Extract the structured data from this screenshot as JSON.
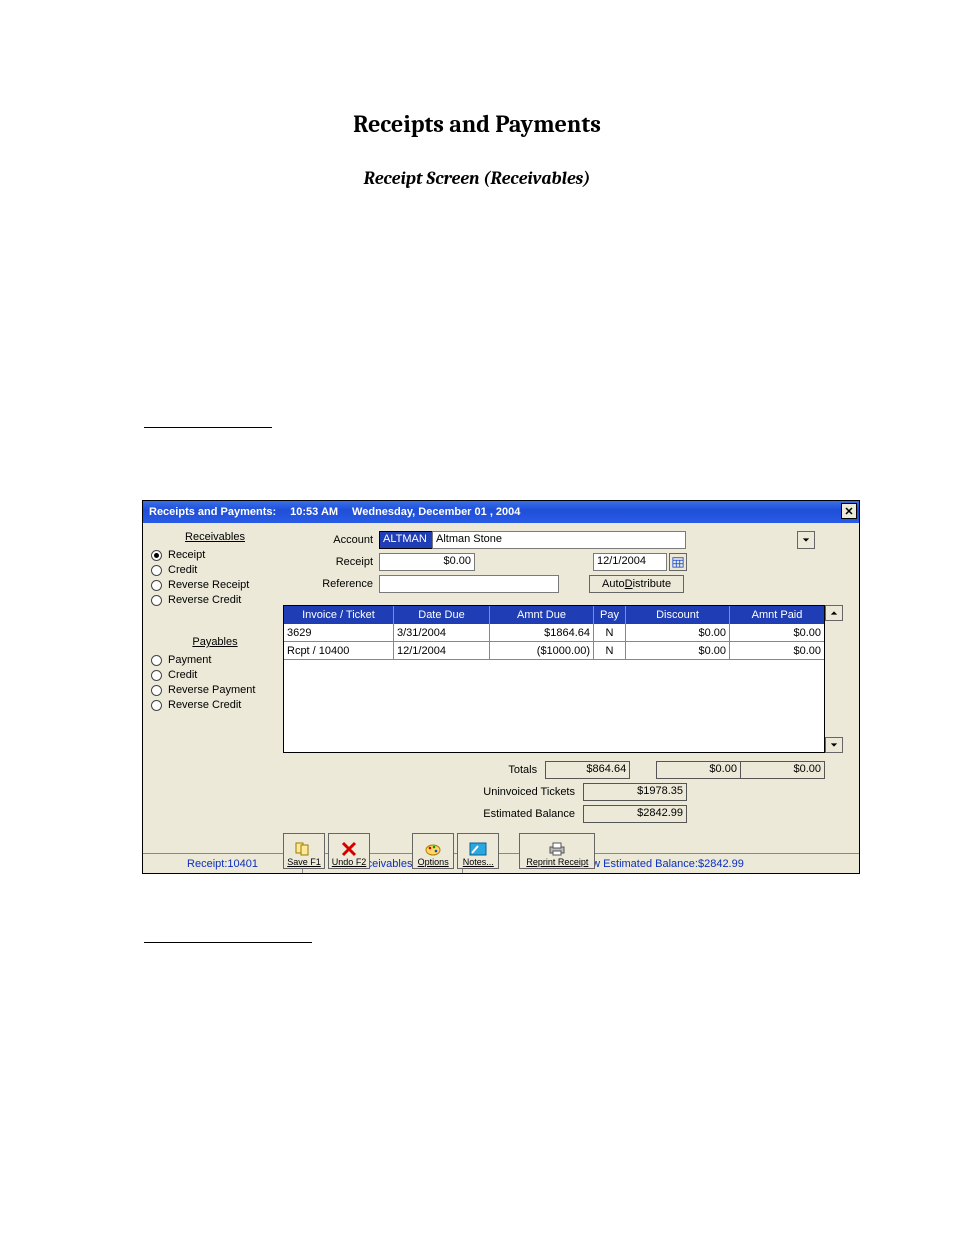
{
  "page_title": "Receipts and Payments",
  "page_subtitle": "Receipt Screen (Receivables)",
  "titlebar": {
    "app": "Receipts and Payments:",
    "time": "10:53 AM",
    "date": "Wednesday, December 01 , 2004"
  },
  "leftPanel": {
    "receivables_header": "Receivables",
    "receivables_options": [
      "Receipt",
      "Credit",
      "Reverse Receipt",
      "Reverse Credit"
    ],
    "receivables_selected_index": 0,
    "payables_header": "Payables",
    "payables_options": [
      "Payment",
      "Credit",
      "Reverse Payment",
      "Reverse Credit"
    ],
    "payables_selected_index": -1
  },
  "form": {
    "account_label": "Account",
    "account_code": "ALTMAN",
    "account_name": "Altman Stone",
    "receipt_label": "Receipt",
    "receipt_amount": "$0.00",
    "date": "12/1/2004",
    "reference_label": "Reference",
    "reference_value": "",
    "auto_distribute_prefix": "Auto ",
    "auto_distribute_hot": "D",
    "auto_distribute_suffix": "istribute"
  },
  "grid": {
    "headers": {
      "invoice": "Invoice / Ticket",
      "date_due": "Date Due",
      "amnt_due": "Amnt Due",
      "pay": "Pay",
      "discount": "Discount",
      "amnt_paid": "Amnt Paid"
    },
    "rows": [
      {
        "invoice": "3629",
        "date_due": "3/31/2004",
        "amnt_due": "$1864.64",
        "pay": "N",
        "discount": "$0.00",
        "amnt_paid": "$0.00"
      },
      {
        "invoice": "Rcpt / 10400",
        "date_due": "12/1/2004",
        "amnt_due": "($1000.00)",
        "pay": "N",
        "discount": "$0.00",
        "amnt_paid": "$0.00"
      }
    ]
  },
  "totals": {
    "totals_label": "Totals",
    "totals_due": "$864.64",
    "totals_disc": "$0.00",
    "totals_paid": "$0.00",
    "uninvoiced_label": "Uninvoiced Tickets",
    "uninvoiced_value": "$1978.35",
    "estbal_label": "Estimated Balance",
    "estbal_value": "$2842.99"
  },
  "toolbar": {
    "save": "Save F1",
    "undo": "Undo F2",
    "options": "Options",
    "notes": "Notes...",
    "reprint": "Reprint Receipt"
  },
  "statusbar": {
    "receipt_prefix": "Receipt:  ",
    "receipt_number": "10401",
    "mode": "Receivables",
    "new_est_prefix": "New Estimated Balance:   ",
    "new_est_value": "$2842.99"
  }
}
